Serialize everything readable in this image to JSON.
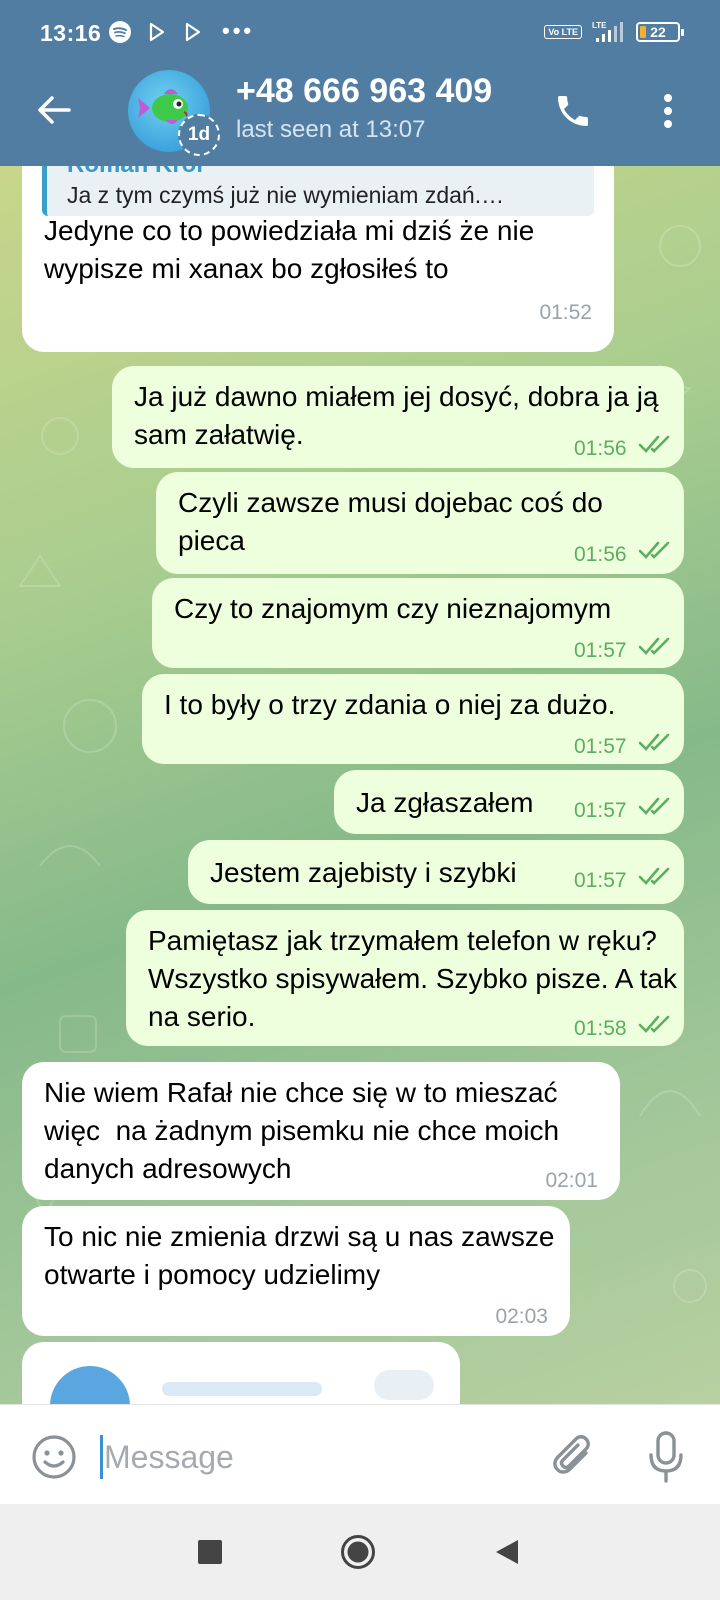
{
  "status_bar": {
    "time": "13:16",
    "more_indicator": "•••",
    "volte": "Vo LTE",
    "network": "LTE",
    "battery": "22",
    "icons": [
      "spotify-icon",
      "play-store-icon",
      "play-icon",
      "wifi-signal-icon",
      "battery-icon"
    ]
  },
  "header": {
    "contact_name": "+48 666 963 409",
    "last_seen": "last seen at 13:07",
    "story_badge": "1d",
    "accent_color": "#517da2"
  },
  "messages": [
    {
      "direction": "in",
      "reply_author": "Roman Król",
      "reply_text": "Ja z tym czymś już nie wymieniam zdań.…",
      "text": "Jedyne co to powiedziała mi dziś że nie wypisze mi xanax bo zgłosiłeś to",
      "time": "01:52"
    },
    {
      "direction": "out",
      "text": "Ja już dawno miałem jej dosyć, dobra ja ją sam załatwię.",
      "time": "01:56"
    },
    {
      "direction": "out",
      "text": "Czyli zawsze musi dojebac coś do pieca",
      "time": "01:56"
    },
    {
      "direction": "out",
      "text": "Czy to znajomym czy nieznajomym",
      "time": "01:57"
    },
    {
      "direction": "out",
      "text": "I to były o trzy zdania o niej za dużo.",
      "time": "01:57"
    },
    {
      "direction": "out",
      "text": "Ja zgłaszałem",
      "time": "01:57"
    },
    {
      "direction": "out",
      "text": "Jestem zajebisty i szybki",
      "time": "01:57"
    },
    {
      "direction": "out",
      "text": "Pamiętasz jak trzymałem telefon w ręku? Wszystko spisywałem. Szybko pisze. A tak na serio.",
      "time": "01:58"
    },
    {
      "direction": "in",
      "text": "Nie wiem Rafał nie chce się w to mieszać więc  na żadnym pisemku nie chce moich danych adresowych",
      "time": "02:01"
    },
    {
      "direction": "in",
      "text": "To nic nie zmienia drzwi są u nas zawsze otwarte i pomocy udzielimy",
      "time": "02:03"
    }
  ],
  "input": {
    "placeholder": "Message"
  },
  "colors": {
    "header": "#517da2",
    "bubble_out": "#eeffde",
    "bubble_in": "#ffffff",
    "time_out": "#5cae5f",
    "reply_accent": "#3ba0c9"
  }
}
